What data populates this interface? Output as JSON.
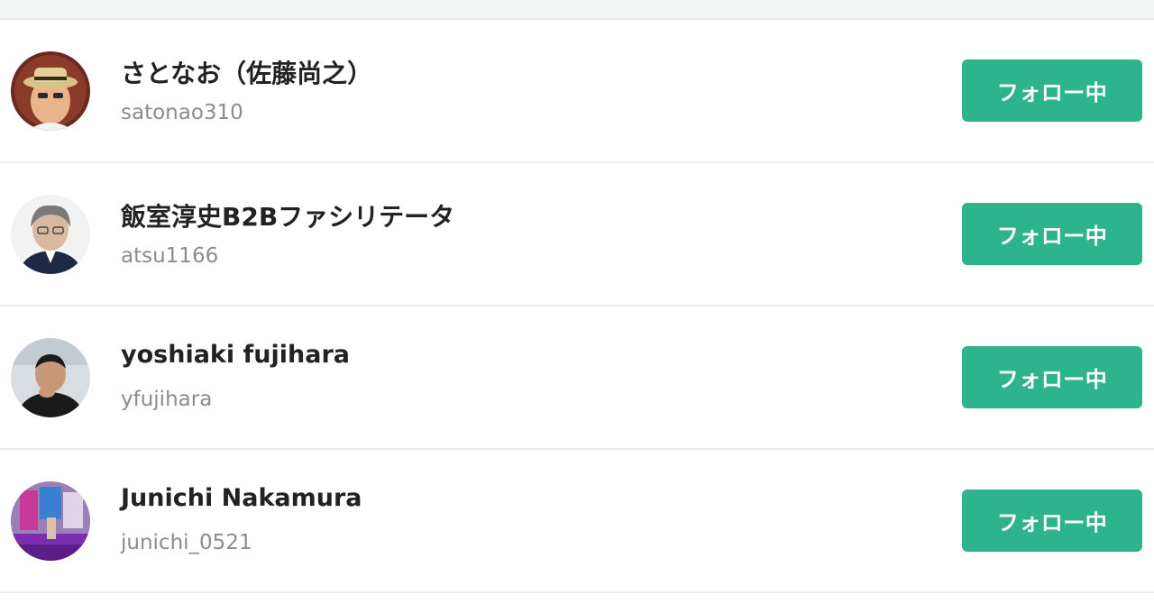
{
  "colors": {
    "accent": "#2eb48d",
    "name_text": "#222222",
    "handle_text": "#8c8c8c",
    "divider": "#ececec"
  },
  "users": [
    {
      "name": "さとなお（佐藤尚之）",
      "handle": "satonao310",
      "button_label": "フォロー中",
      "avatar_icon": "avatar-person-hat"
    },
    {
      "name": "飯室淳史B2Bファシリテータ",
      "handle": "atsu1166",
      "button_label": "フォロー中",
      "avatar_icon": "avatar-person-glasses"
    },
    {
      "name": "yoshiaki fujihara",
      "handle": "yfujihara",
      "button_label": "フォロー中",
      "avatar_icon": "avatar-person"
    },
    {
      "name": "Junichi Nakamura",
      "handle": "junichi_0521",
      "button_label": "フォロー中",
      "avatar_icon": "avatar-stage-photo"
    }
  ]
}
